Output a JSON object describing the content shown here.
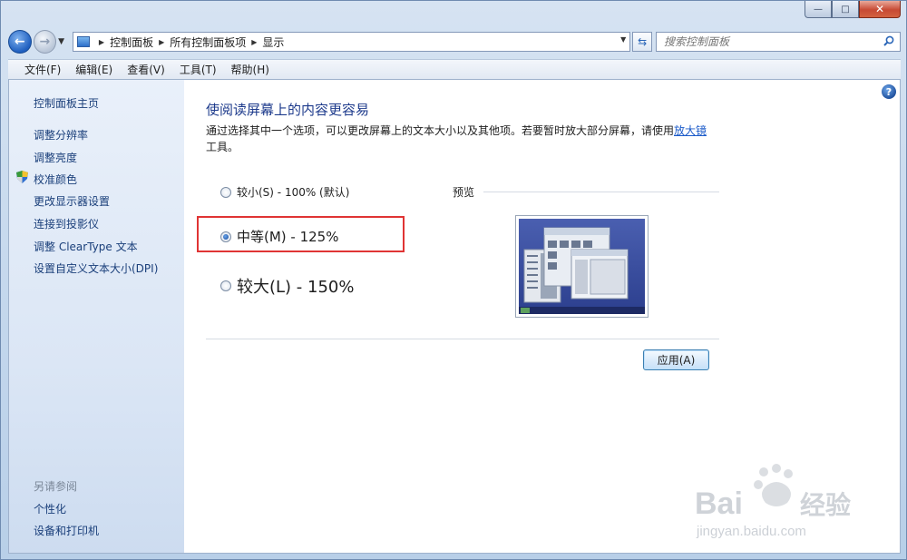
{
  "window": {
    "caption_buttons": {
      "minimize": "—",
      "maximize": "□",
      "close": "✕"
    }
  },
  "nav": {
    "breadcrumb": [
      "控制面板",
      "所有控制面板项",
      "显示"
    ],
    "search_placeholder": "搜索控制面板"
  },
  "menu": [
    "文件(F)",
    "编辑(E)",
    "查看(V)",
    "工具(T)",
    "帮助(H)"
  ],
  "sidebar": {
    "home": "控制面板主页",
    "links": [
      "调整分辨率",
      "调整亮度",
      "校准颜色",
      "更改显示器设置",
      "连接到投影仪",
      "调整 ClearType 文本",
      "设置自定义文本大小(DPI)"
    ],
    "see_also_heading": "另请参阅",
    "see_also": [
      "个性化",
      "设备和打印机"
    ]
  },
  "main": {
    "title": "使阅读屏幕上的内容更容易",
    "description_before": "通过选择其中一个选项，可以更改屏幕上的文本大小以及其他项。若要暂时放大部分屏幕，请使用",
    "description_link": "放大镜",
    "description_after": "工具。",
    "options": [
      {
        "label": "较小(S) - 100% (默认)",
        "checked": false
      },
      {
        "label": "中等(M) - 125%",
        "checked": true
      },
      {
        "label": "较大(L) - 150%",
        "checked": false
      }
    ],
    "preview_label": "预览",
    "apply_label": "应用(A)",
    "help": "?"
  },
  "watermark": {
    "brand": "Bai",
    "brand_suffix": "经验",
    "url": "jingyan.baidu.com"
  },
  "colors": {
    "link": "#1a3f7a",
    "title": "#1e3b8c",
    "highlight": "#e03434"
  }
}
